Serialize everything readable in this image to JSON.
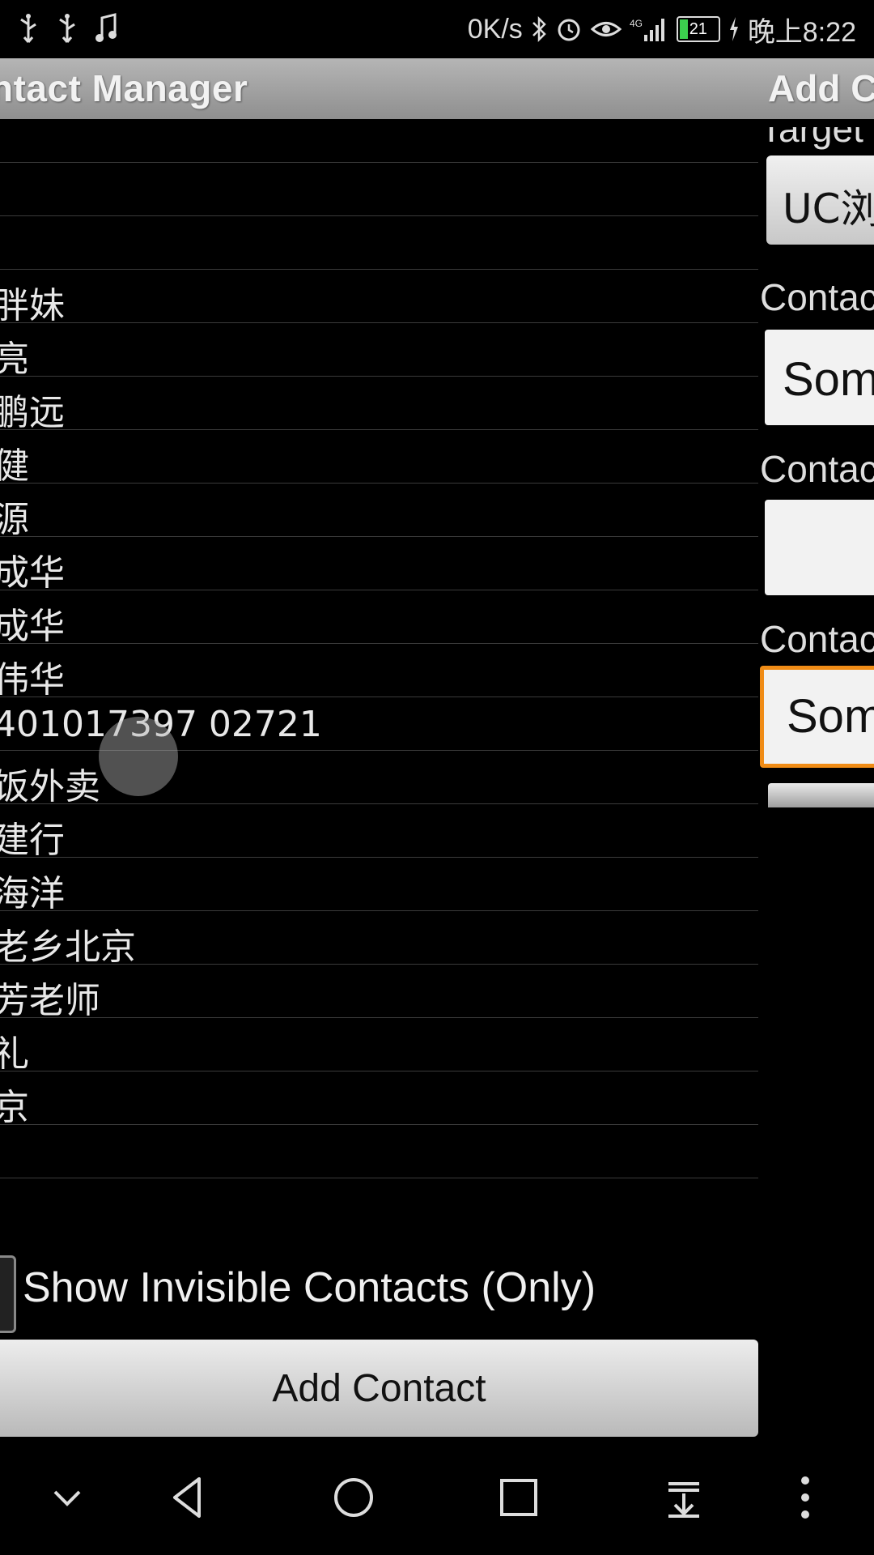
{
  "status_bar": {
    "icons_left": [
      "usb-icon",
      "usb-icon",
      "music-note-icon"
    ],
    "speed": "0K/s",
    "battery": "21",
    "time": "晚上8:22"
  },
  "contact_manager": {
    "title": "ntact Manager",
    "contacts": [
      "",
      "",
      "",
      "胖妹",
      "亮",
      "鹏远",
      "健",
      "源",
      "成华",
      "成华",
      "伟华",
      "401017397 02721",
      "饭外卖",
      "建行",
      "海洋",
      "老乡北京",
      "芳老师",
      "礼",
      "京",
      ""
    ],
    "show_invisible_label": "Show Invisible Contacts (Only)",
    "add_contact_button": "Add Contact"
  },
  "add_contact": {
    "title": "Add C",
    "target_label": "Target",
    "target_value": "UC浏",
    "contact_label_1": "Contac",
    "contact_value_1": "Som",
    "contact_label_2": "Contac",
    "contact_value_2": "",
    "contact_label_3": "Contac",
    "contact_value_3": "Som"
  },
  "nav_bar": {
    "icons": [
      "chevron-down-icon",
      "back-icon",
      "home-icon",
      "recents-icon",
      "pull-down-icon",
      "more-icon"
    ]
  },
  "colors": {
    "focus_border": "#f08c16",
    "battery_fill": "#3ccf4e"
  }
}
